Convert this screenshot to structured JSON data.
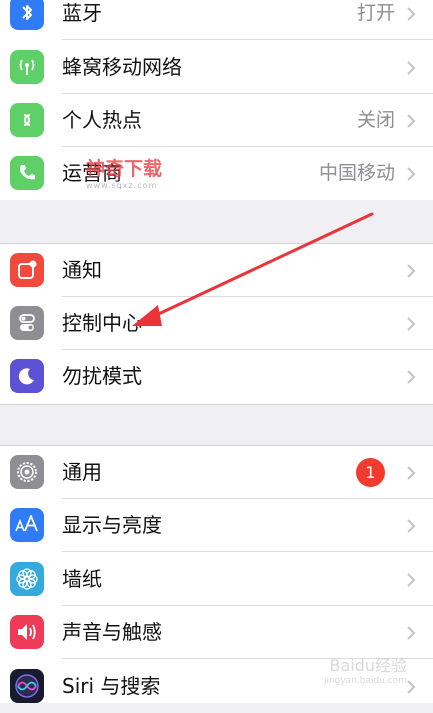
{
  "group1": [
    {
      "label": "蓝牙",
      "value": "打开",
      "icon": "bluetooth-icon",
      "color": "#2f7cf6"
    },
    {
      "label": "蜂窝移动网络",
      "value": "",
      "icon": "cellular-icon",
      "color": "#5fd068"
    },
    {
      "label": "个人热点",
      "value": "关闭",
      "icon": "hotspot-icon",
      "color": "#5fd068"
    },
    {
      "label": "运营商",
      "value": "中国移动",
      "icon": "phone-icon",
      "color": "#5fd068"
    }
  ],
  "group2": [
    {
      "label": "通知",
      "icon": "notification-icon",
      "color": "#ef4a3c"
    },
    {
      "label": "控制中心",
      "icon": "control-center-icon",
      "color": "#8e8e93"
    },
    {
      "label": "勿扰模式",
      "icon": "moon-icon",
      "color": "#5b52d6"
    }
  ],
  "group3": [
    {
      "label": "通用",
      "badge": "1",
      "icon": "gear-icon",
      "color": "#8e8e93"
    },
    {
      "label": "显示与亮度",
      "icon": "display-icon",
      "color": "#2f7cf6"
    },
    {
      "label": "墙纸",
      "icon": "wallpaper-icon",
      "color": "#36aadc"
    },
    {
      "label": "声音与触感",
      "icon": "sound-icon",
      "color": "#ef3b57"
    },
    {
      "label": "Siri 与搜索",
      "icon": "siri-icon",
      "color": "#1a1a2e"
    }
  ],
  "watermark": {
    "title": "神奇下载",
    "url": "www.sqxz.com"
  },
  "baidu_watermark": {
    "title": "Baidu经验",
    "url": "jingyan.baidu.com"
  },
  "annotation": {
    "arrow_color": "#e8343a"
  }
}
